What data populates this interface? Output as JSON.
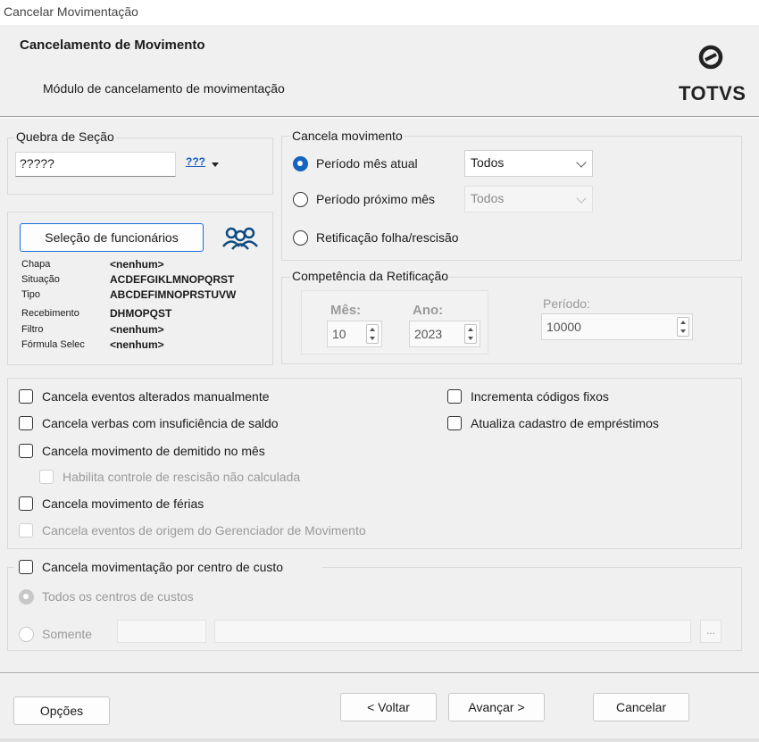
{
  "window": {
    "title": "Cancelar Movimentação"
  },
  "header": {
    "title": "Cancelamento de Movimento",
    "subtitle": "Módulo de cancelamento de movimentação",
    "logo_text": "TOTVS"
  },
  "quebra": {
    "label": "Quebra de Seção",
    "value": "?????",
    "button_text": "???"
  },
  "selecao": {
    "button_label": "Seleção de funcionários",
    "fields": [
      {
        "label": "Chapa",
        "value": "<nenhum>"
      },
      {
        "label": "Situação",
        "value": "ACDEFGIKLMNOPQRST"
      },
      {
        "label": "Tipo",
        "value": "ABCDEFIMNOPRSTUVW"
      },
      {
        "label": "Recebimento",
        "value": "DHMOPQST"
      },
      {
        "label": "Filtro",
        "value": "<nenhum>"
      },
      {
        "label": "Fórmula Selec",
        "value": "<nenhum>"
      }
    ]
  },
  "cancela_movimento": {
    "label": "Cancela movimento",
    "options": [
      {
        "label": "Período mês atual",
        "selected": true,
        "select_value": "Todos"
      },
      {
        "label": "Período próximo mês",
        "selected": false,
        "select_value": "Todos",
        "disabled": true
      },
      {
        "label": "Retificação folha/rescisão",
        "selected": false
      }
    ]
  },
  "competencia": {
    "label": "Competência da Retificação",
    "mes_label": "Mês:",
    "mes_value": "10",
    "ano_label": "Ano:",
    "ano_value": "2023",
    "periodo_label": "Período:",
    "periodo_value": "10000"
  },
  "checks_left": [
    {
      "label": "Cancela eventos alterados manualmente",
      "checked": false,
      "disabled": false
    },
    {
      "label": "Cancela verbas com insuficiência de saldo",
      "checked": false,
      "disabled": false
    },
    {
      "label": "Cancela movimento de demitido no mês",
      "checked": false,
      "disabled": false
    },
    {
      "label": "Habilita controle de rescisão não calculada",
      "checked": false,
      "disabled": true
    },
    {
      "label": "Cancela movimento de férias",
      "checked": false,
      "disabled": false
    },
    {
      "label": "Cancela eventos de origem do Gerenciador de Movimento",
      "checked": false,
      "disabled": true
    }
  ],
  "checks_right": [
    {
      "label": "Incrementa códigos fixos",
      "checked": false
    },
    {
      "label": "Atualiza cadastro de empréstimos",
      "checked": false
    }
  ],
  "centro_custo": {
    "label": "Cancela movimentação por centro de custo",
    "opt_todos": "Todos os centros de custos",
    "opt_somente": "Somente",
    "browse": "..."
  },
  "footer": {
    "opcoes": "Opções",
    "voltar": "< Voltar",
    "avancar": "Avançar >",
    "cancelar": "Cancelar"
  }
}
